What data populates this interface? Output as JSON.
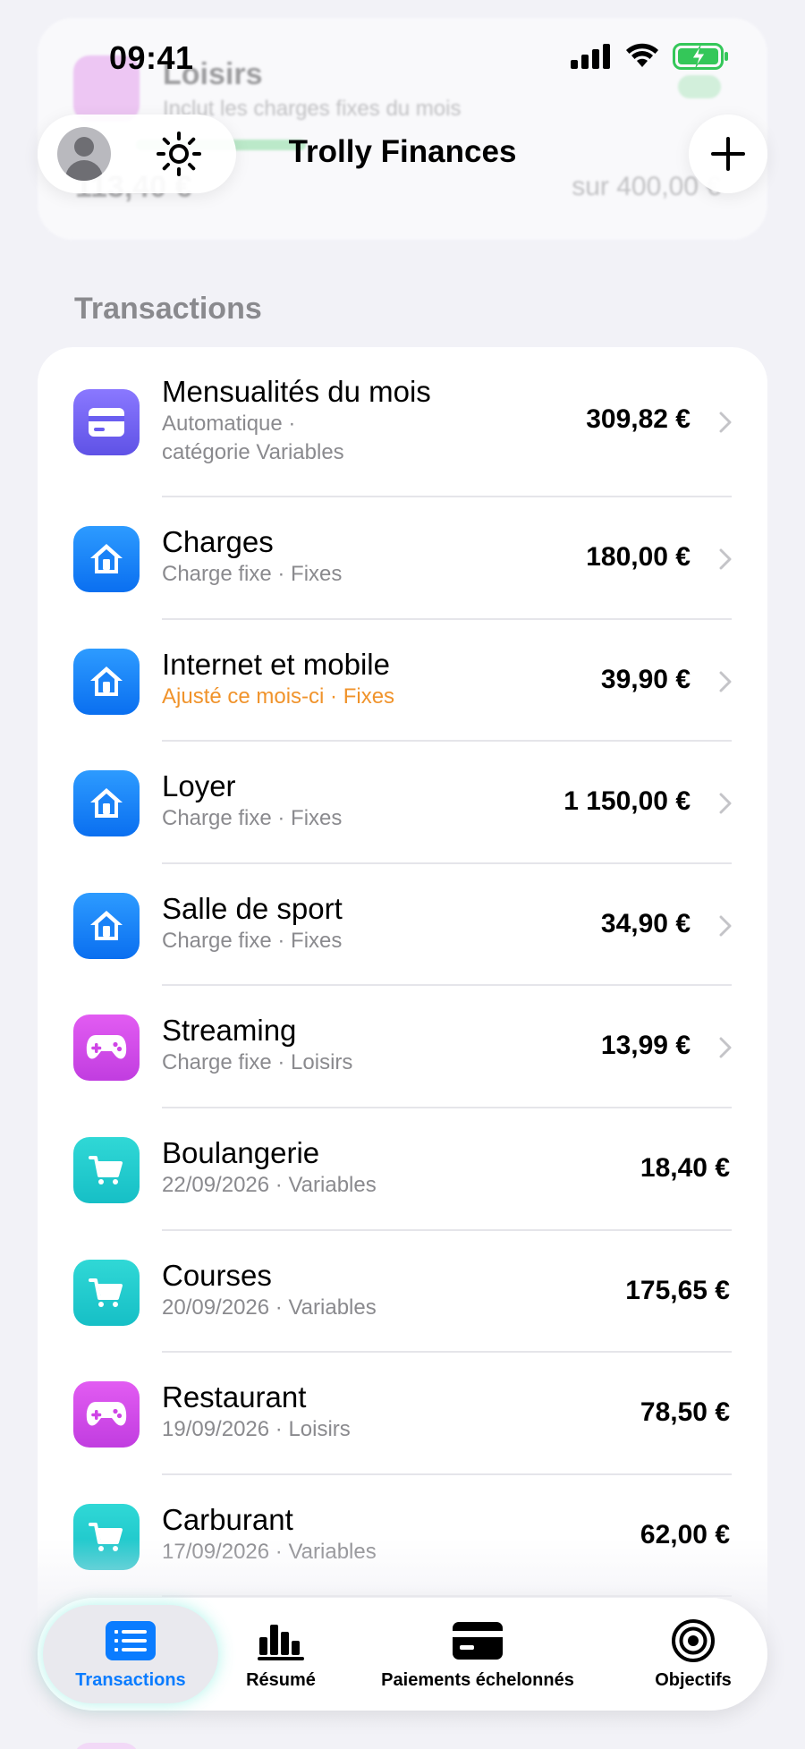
{
  "status_bar": {
    "time": "09:41",
    "icons": [
      "signal-icon",
      "wifi-icon",
      "battery-charging-icon"
    ]
  },
  "background_card": {
    "category": "Loisirs",
    "subtitle": "Inclut les charges fixes du mois",
    "amount": "113,40 €",
    "budget": "sur 400,00 €"
  },
  "header": {
    "title": "Trolly Finances",
    "avatar_icon": "person-icon",
    "theme_icon": "sun-icon",
    "add_icon": "plus-icon"
  },
  "section": {
    "title": "Transactions"
  },
  "transactions": [
    {
      "title": "Mensualités du mois",
      "subtitle_1": "Automatique ·",
      "subtitle_2": "catégorie Variables",
      "amount": "309,82 €",
      "icon": "card-icon",
      "color": "purple",
      "chevron": true
    },
    {
      "title": "Charges",
      "subtitle": "Charge fixe · Fixes",
      "amount": "180,00 €",
      "icon": "house-icon",
      "color": "blue",
      "chevron": true
    },
    {
      "title": "Internet et mobile",
      "subtitle": "Ajusté ce mois-ci · Fixes",
      "amount": "39,90 €",
      "icon": "house-icon",
      "color": "blue",
      "chevron": true,
      "subtitle_color": "#f0932b"
    },
    {
      "title": "Loyer",
      "subtitle": "Charge fixe · Fixes",
      "amount": "1 150,00 €",
      "icon": "house-icon",
      "color": "blue",
      "chevron": true
    },
    {
      "title": "Salle de sport",
      "subtitle": "Charge fixe · Fixes",
      "amount": "34,90 €",
      "icon": "house-icon",
      "color": "blue",
      "chevron": true
    },
    {
      "title": "Streaming",
      "subtitle": "Charge fixe · Loisirs",
      "amount": "13,99 €",
      "icon": "gamepad-icon",
      "color": "pink",
      "chevron": true
    },
    {
      "title": "Boulangerie",
      "subtitle": "22/09/2026 · Variables",
      "amount": "18,40 €",
      "icon": "cart-icon",
      "color": "teal",
      "chevron": false
    },
    {
      "title": "Courses",
      "subtitle": "20/09/2026 · Variables",
      "amount": "175,65 €",
      "icon": "cart-icon",
      "color": "teal",
      "chevron": false
    },
    {
      "title": "Restaurant",
      "subtitle": "19/09/2026 · Loisirs",
      "amount": "78,50 €",
      "icon": "gamepad-icon",
      "color": "pink",
      "chevron": false
    },
    {
      "title": "Carburant",
      "subtitle": "17/09/2026 · Variables",
      "amount": "62,00 €",
      "icon": "cart-icon",
      "color": "teal",
      "chevron": false
    }
  ],
  "tab_bar": {
    "tabs": [
      {
        "label": "Transactions",
        "icon": "list-icon",
        "active": true
      },
      {
        "label": "Résumé",
        "icon": "bar-chart-icon",
        "active": false
      },
      {
        "label": "Paiements échelonnés",
        "icon": "card-icon",
        "active": false
      },
      {
        "label": "Objectifs",
        "icon": "target-icon",
        "active": false
      }
    ]
  },
  "colors": {
    "accent": "#0a7cff",
    "warning": "#f0932b",
    "purple": "#6c5ce7",
    "blue": "#0a84ff",
    "pink": "#cc44e6",
    "teal": "#1ccbcb"
  }
}
